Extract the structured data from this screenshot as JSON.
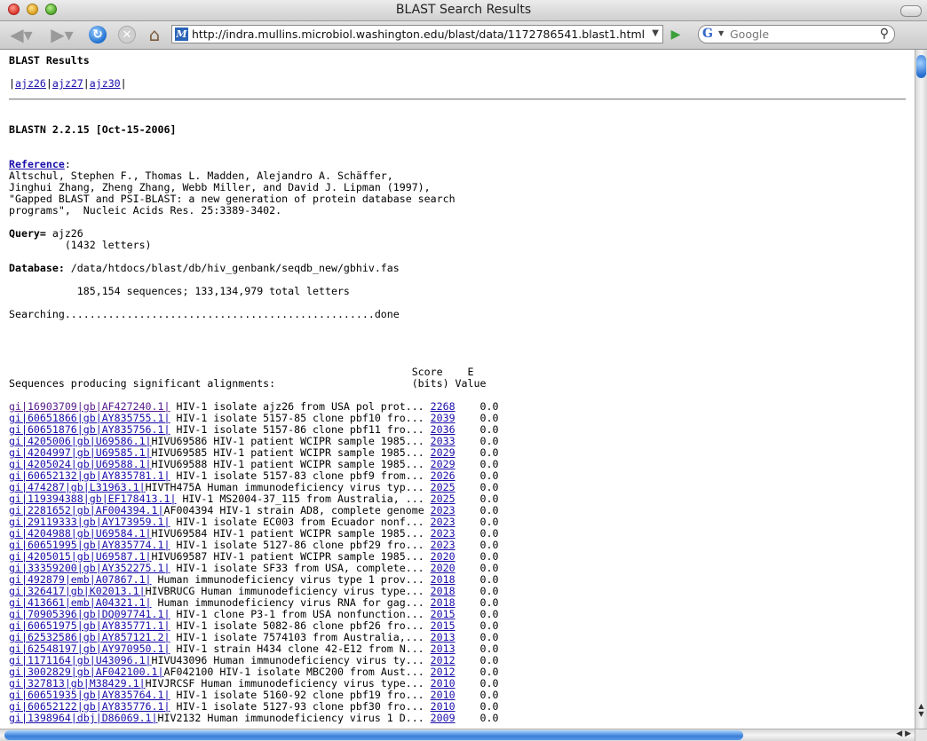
{
  "window": {
    "title": "BLAST Search Results"
  },
  "toolbar": {
    "url": "http://indra.mullins.microbiol.washington.edu/blast/data/1172786541.blast1.html",
    "search_engine": "Google",
    "search_placeholder": "Google"
  },
  "page": {
    "heading": "BLAST Results",
    "nav_links": [
      "ajz26",
      "ajz27",
      "ajz30"
    ],
    "version": "BLASTN 2.2.15 [Oct-15-2006]",
    "reference_label": "Reference",
    "reference_text": "Altschul, Stephen F., Thomas L. Madden, Alejandro A. Schäffer,\nJinghui Zhang, Zheng Zhang, Webb Miller, and David J. Lipman (1997),\n\"Gapped BLAST and PSI-BLAST: a new generation of protein database search\nprograms\",  Nucleic Acids Res. 25:3389-3402.",
    "query_label": "Query=",
    "query_value": " ajz26",
    "query_letters": "         (1432 letters)",
    "database_label": "Database:",
    "database_value": " /data/htdocs/blast/db/hiv_genbank/seqdb_new/gbhiv.fas",
    "database_stats": "           185,154 sequences; 133,134,979 total letters",
    "searching": "Searching..................................................done",
    "score_header": "                                                                 Score    E",
    "table_header": "Sequences producing significant alignments:                      (bits) Value",
    "hits": [
      {
        "link": "gi|16903709|gb|AF427240.1|",
        "desc": " HIV-1 isolate ajz26 from USA pol prot...",
        "score": "2268",
        "evalue": "0.0",
        "visited": true
      },
      {
        "link": "gi|60651866|gb|AY835755.1|",
        "desc": " HIV-1 isolate 5157-85 clone pbf10 fro...",
        "score": "2039",
        "evalue": "0.0"
      },
      {
        "link": "gi|60651876|gb|AY835756.1|",
        "desc": " HIV-1 isolate 5157-86 clone pbf11 fro...",
        "score": "2036",
        "evalue": "0.0"
      },
      {
        "link": "gi|4205006|gb|U69586.1|",
        "desc": "HIVU69586 HIV-1 patient WCIPR sample 1985...",
        "score": "2033",
        "evalue": "0.0"
      },
      {
        "link": "gi|4204997|gb|U69585.1|",
        "desc": "HIVU69585 HIV-1 patient WCIPR sample 1985...",
        "score": "2029",
        "evalue": "0.0"
      },
      {
        "link": "gi|4205024|gb|U69588.1|",
        "desc": "HIVU69588 HIV-1 patient WCIPR sample 1985...",
        "score": "2029",
        "evalue": "0.0"
      },
      {
        "link": "gi|60652132|gb|AY835781.1|",
        "desc": " HIV-1 isolate 5157-83 clone pbf9 from...",
        "score": "2026",
        "evalue": "0.0"
      },
      {
        "link": "gi|474287|gb|L31963.1|",
        "desc": "HIVTH475A Human immunodeficiency virus typ...",
        "score": "2025",
        "evalue": "0.0"
      },
      {
        "link": "gi|119394388|gb|EF178413.1|",
        "desc": " HIV-1 MS2004-37_115 from Australia, ...",
        "score": "2025",
        "evalue": "0.0"
      },
      {
        "link": "gi|2281652|gb|AF004394.1|",
        "desc": "AF004394 HIV-1 strain AD8, complete genome",
        "score": "2023",
        "evalue": "0.0"
      },
      {
        "link": "gi|29119333|gb|AY173959.1|",
        "desc": " HIV-1 isolate EC003 from Ecuador nonf...",
        "score": "2023",
        "evalue": "0.0"
      },
      {
        "link": "gi|4204988|gb|U69584.1|",
        "desc": "HIVU69584 HIV-1 patient WCIPR sample 1985...",
        "score": "2023",
        "evalue": "0.0"
      },
      {
        "link": "gi|60651995|gb|AY835774.1|",
        "desc": " HIV-1 isolate 5127-86 clone pbf29 fro...",
        "score": "2023",
        "evalue": "0.0"
      },
      {
        "link": "gi|4205015|gb|U69587.1|",
        "desc": "HIVU69587 HIV-1 patient WCIPR sample 1985...",
        "score": "2020",
        "evalue": "0.0"
      },
      {
        "link": "gi|33359200|gb|AY352275.1|",
        "desc": " HIV-1 isolate SF33 from USA, complete...",
        "score": "2020",
        "evalue": "0.0"
      },
      {
        "link": "gi|492879|emb|A07867.1|",
        "desc": " Human immunodeficiency virus type 1 prov...",
        "score": "2018",
        "evalue": "0.0"
      },
      {
        "link": "gi|326417|gb|K02013.1|",
        "desc": "HIVBRUCG Human immunodeficiency virus type...",
        "score": "2018",
        "evalue": "0.0"
      },
      {
        "link": "gi|413661|emb|A04321.1|",
        "desc": " Human immunodeficiency virus RNA for gag...",
        "score": "2018",
        "evalue": "0.0"
      },
      {
        "link": "gi|70905396|gb|DQ097741.1|",
        "desc": " HIV-1 clone P3-1 from USA nonfunction...",
        "score": "2015",
        "evalue": "0.0"
      },
      {
        "link": "gi|60651975|gb|AY835771.1|",
        "desc": " HIV-1 isolate 5082-86 clone pbf26 fro...",
        "score": "2015",
        "evalue": "0.0"
      },
      {
        "link": "gi|62532586|gb|AY857121.2|",
        "desc": " HIV-1 isolate 7574103 from Australia,...",
        "score": "2013",
        "evalue": "0.0"
      },
      {
        "link": "gi|62548197|gb|AY970950.1|",
        "desc": " HIV-1 strain H434 clone 42-E12 from N...",
        "score": "2013",
        "evalue": "0.0"
      },
      {
        "link": "gi|1171164|gb|U43096.1|",
        "desc": "HIVU43096 Human immunodeficiency virus ty...",
        "score": "2012",
        "evalue": "0.0"
      },
      {
        "link": "gi|3002829|gb|AF042100.1|",
        "desc": "AF042100 HIV-1 isolate MBC200 from Aust...",
        "score": "2012",
        "evalue": "0.0"
      },
      {
        "link": "gi|327813|gb|M38429.1|",
        "desc": "HIVJRCSF Human immunodeficiency virus type...",
        "score": "2010",
        "evalue": "0.0"
      },
      {
        "link": "gi|60651935|gb|AY835764.1|",
        "desc": " HIV-1 isolate 5160-92 clone pbf19 fro...",
        "score": "2010",
        "evalue": "0.0"
      },
      {
        "link": "gi|60652122|gb|AY835776.1|",
        "desc": " HIV-1 isolate 5127-93 clone pbf30 fro...",
        "score": "2010",
        "evalue": "0.0"
      },
      {
        "link": "gi|1398964|dbj|D86069.1|",
        "desc": "HIV2132 Human immunodeficiency virus 1 D...",
        "score": "2009",
        "evalue": "0.0"
      }
    ]
  }
}
